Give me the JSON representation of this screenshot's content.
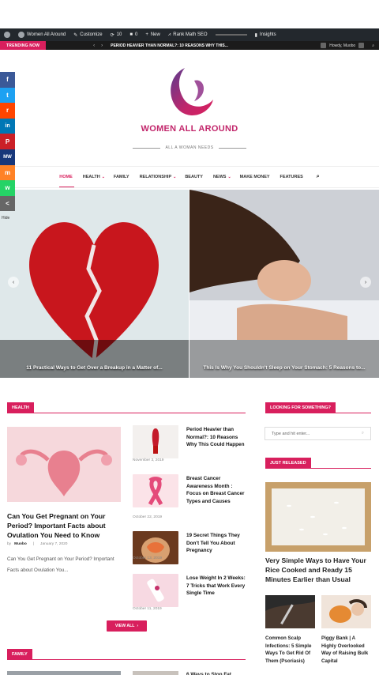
{
  "admin_bar": {
    "site_name": "Women All Around",
    "customize": "Customize",
    "updates": "10",
    "comments": "0",
    "new": "New",
    "seo": "Rank Math SEO",
    "insights": "Insights"
  },
  "trending": {
    "label": "TRENDING NOW",
    "headline": "PERIOD HEAVIER THAN NORMAL?: 10 REASONS WHY THIS...",
    "user_greeting": "Howdy, Muobo"
  },
  "logo": {
    "text": "WOMEN ALL AROUND",
    "tagline": "ALL A WOMAN NEEDS"
  },
  "nav": [
    {
      "label": "HOME",
      "caret": ""
    },
    {
      "label": "HEALTH",
      "caret": "⌄"
    },
    {
      "label": "FAMILY",
      "caret": ""
    },
    {
      "label": "RELATIONSHIP",
      "caret": "⌄"
    },
    {
      "label": "BEAUTY",
      "caret": ""
    },
    {
      "label": "NEWS",
      "caret": "⌄"
    },
    {
      "label": "MAKE MONEY",
      "caret": ""
    },
    {
      "label": "FEATURES",
      "caret": ""
    }
  ],
  "social": [
    {
      "icon": "facebook-icon",
      "glyph": "f",
      "color": "#3b5998"
    },
    {
      "icon": "twitter-icon",
      "glyph": "t",
      "color": "#1da1f2"
    },
    {
      "icon": "reddit-icon",
      "glyph": "r",
      "color": "#ff4500"
    },
    {
      "icon": "linkedin-icon",
      "glyph": "in",
      "color": "#0077b5"
    },
    {
      "icon": "pinterest-icon",
      "glyph": "P",
      "color": "#cb2027"
    },
    {
      "icon": "mewe-icon",
      "glyph": "MW",
      "color": "#17377a"
    },
    {
      "icon": "mix-icon",
      "glyph": "m",
      "color": "#ff8226"
    },
    {
      "icon": "whatsapp-icon",
      "glyph": "w",
      "color": "#25d366"
    },
    {
      "icon": "more-icon",
      "glyph": "<",
      "color": "#666666"
    }
  ],
  "hide": "Hide",
  "slider": [
    {
      "caption": "11 Practical Ways to Get Over a Breakup in a Matter of..."
    },
    {
      "caption": "This Is Why You Shouldn't Sleep on Your Stomach: 5 Reasons to..."
    }
  ],
  "health": {
    "heading": "HEALTH",
    "featured": {
      "title": "Can You Get Pregnant on Your Period? Important Facts about Ovulation You Need to Know",
      "by": "by",
      "author": "Muobo",
      "date": "January 7, 2020",
      "excerpt": "Can You Get Pregnant on Your Period? Important Facts about Ovulation You..."
    },
    "list": [
      {
        "title": "Period Heavier than Normal?: 10 Reasons Why This Could Happen",
        "date": "November 3, 2019"
      },
      {
        "title": "Breast Cancer Awareness Month : Focus on Breast Cancer Types and Causes",
        "date": "October 22, 2019"
      },
      {
        "title": "19 Secret Things They Don't Tell You About Pregnancy",
        "date": "October 13, 2019"
      },
      {
        "title": "Lose Weight In 2 Weeks: 7 Tricks that Work Every Single Time",
        "date": "October 11, 2019"
      }
    ],
    "view_all": "VIEW ALL"
  },
  "family": {
    "heading": "FAMILY",
    "teaser_title": "6 Ways to Stop Fat..."
  },
  "sidebar": {
    "search_heading": "LOOKING FOR SOMETHING?",
    "search_placeholder": "Type and hit enter...",
    "released_heading": "JUST RELEASED",
    "featured_title": "Very Simple Ways to Have Your Rice Cooked and Ready 15 Minutes Earlier than Usual",
    "small": [
      {
        "title": "Common Scalp Infections: 5 Simple Ways To Get Rid Of Them (Psoriasis)"
      },
      {
        "title": "Piggy Bank | A Highly Overlooked Way of Raising Bulk Capital"
      }
    ]
  }
}
